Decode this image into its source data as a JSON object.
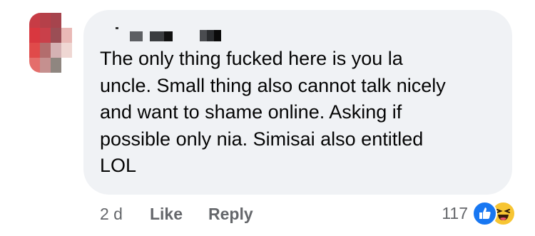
{
  "comment": {
    "text": "The only thing fucked here is you la\nuncle. Small thing also cannot talk nicely\nand want to shame online. Asking if\npossible only nia. Simisai also entitled\nLOL"
  },
  "actions": {
    "time": "2 d",
    "like_label": "Like",
    "reply_label": "Reply"
  },
  "reactions": {
    "count": "117",
    "icons": [
      "like-icon",
      "haha-icon"
    ]
  },
  "colors": {
    "bubble": "#f0f2f5",
    "text": "#050505",
    "meta": "#65676b",
    "like_blue": "#1877f2",
    "haha_yellow": "#f7c533"
  }
}
